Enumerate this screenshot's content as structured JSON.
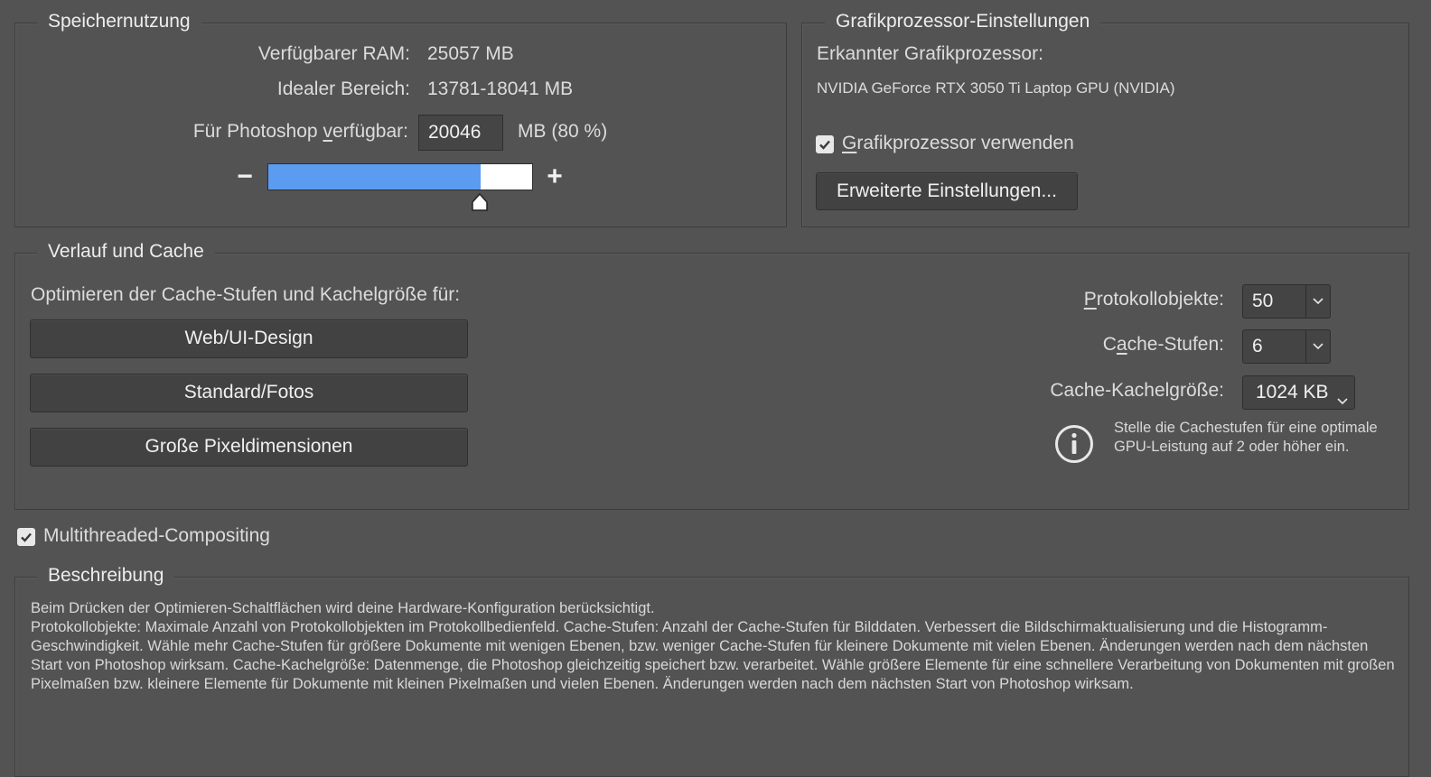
{
  "memory": {
    "legend": "Speichernutzung",
    "ram_label": "Verfügbarer RAM:",
    "ram_value": "25057 MB",
    "ideal_label": "Idealer Bereich:",
    "ideal_value": "13781-18041 MB",
    "ps_label_pre": "Für Photoshop ",
    "ps_label_ul": "v",
    "ps_label_post": "erfügbar:",
    "ps_value": "20046",
    "ps_unit": "MB (80 %)",
    "slider_fraction": 0.8,
    "minus": "−",
    "plus": "+"
  },
  "gpu": {
    "legend": "Grafikprozessor-Einstellungen",
    "detected_label": "Erkannter Grafikprozessor:",
    "detected_value": "NVIDIA GeForce RTX 3050 Ti Laptop GPU (NVIDIA)",
    "use_gpu_ul": "G",
    "use_gpu_rest": "rafikprozessor verwenden",
    "use_gpu_checked": true,
    "advanced_button": "Erweiterte Einstellungen..."
  },
  "history": {
    "legend": "Verlauf und Cache",
    "optimize_label": "Optimieren der Cache-Stufen und Kachelgröße für:",
    "btn_web": "Web/UI-Design",
    "btn_standard": "Standard/Fotos",
    "btn_large": "Große Pixeldimensionen",
    "history_states_ul": "P",
    "history_states_rest": "rotokollobjekte:",
    "history_states_value": "50",
    "cache_levels_pre": "C",
    "cache_levels_ul": "a",
    "cache_levels_post": "che-Stufen:",
    "cache_levels_value": "6",
    "tile_size_label": "Cache-Kachelgröße:",
    "tile_size_value": "1024 KB",
    "info_text": "Stelle die Cachestufen für eine optimale GPU-Leistung auf 2 oder höher ein."
  },
  "multithreaded": {
    "label": "Multithreaded-Compositing",
    "checked": true
  },
  "description": {
    "legend": "Beschreibung",
    "line1": "Beim Drücken der Optimieren-Schaltflächen wird deine Hardware-Konfiguration berücksichtigt.",
    "line2": "Protokollobjekte: Maximale Anzahl von Protokollobjekten im Protokollbedienfeld. Cache-Stufen: Anzahl der Cache-Stufen für Bilddaten. Verbessert die Bildschirmaktualisierung und die Histogramm-Geschwindigkeit. Wähle mehr Cache-Stufen für größere Dokumente mit wenigen Ebenen, bzw. weniger Cache-Stufen für kleinere Dokumente mit vielen Ebenen. Änderungen werden nach dem nächsten Start von Photoshop wirksam. Cache-Kachelgröße: Datenmenge, die Photoshop gleichzeitig speichert bzw. verarbeitet. Wähle größere Elemente für eine schnellere Verarbeitung von Dokumenten mit großen Pixelmaßen bzw. kleinere Elemente für Dokumente mit kleinen Pixelmaßen und vielen Ebenen. Änderungen werden nach dem nächsten Start von Photoshop wirksam."
  },
  "colors": {
    "background": "#535353",
    "slider_fill": "#5b9bf0",
    "slider_track": "#ffffff"
  },
  "icons": [
    "minus-icon",
    "plus-icon",
    "slider-thumb-icon",
    "checkmark-icon",
    "chevron-down-icon",
    "info-icon"
  ]
}
